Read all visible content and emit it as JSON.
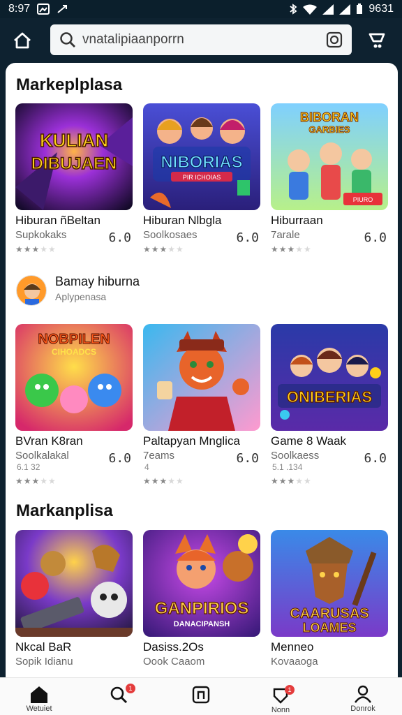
{
  "status_bar": {
    "time": "8:97",
    "battery": "9631"
  },
  "search": {
    "value": "vnatalipiaanporrn"
  },
  "sections": [
    {
      "title": "Markeplplasa"
    },
    {
      "title": "Markanplisa"
    }
  ],
  "row1": [
    {
      "thumb_text": [
        "KULIAN",
        "DIBUJAEN"
      ],
      "name": "Hiburan ñBeltan",
      "sub": "Supkokaks",
      "rating": 3,
      "price": "6.0"
    },
    {
      "thumb_text": [
        "NIBORIAS",
        "PIR ICHOIAS"
      ],
      "name": "Hiburan Nlbgla",
      "sub": "Soolkosaes",
      "rating": 3,
      "price": "6.0"
    },
    {
      "thumb_text": [
        "BIBORAN",
        "GARBIES",
        "PIURO"
      ],
      "name": "Hiburraan",
      "sub": "7arale",
      "rating": 3,
      "price": "6.0"
    }
  ],
  "developer": {
    "name": "Bamay hiburna",
    "sub": "Aplypenasa"
  },
  "row2": [
    {
      "thumb_text": [
        "NOBPILEN",
        "CIHOADCS"
      ],
      "name": "BVran K8ran",
      "sub": "Soolkalakal",
      "extra": "6.1 32",
      "rating": 3,
      "price": "6.0"
    },
    {
      "thumb_text": [],
      "name": "Paltapyan Mnglica",
      "sub": "7eams",
      "extra": "4",
      "rating": 3,
      "price": "6.0"
    },
    {
      "thumb_text": [
        "ONIBERIAS"
      ],
      "name": "Game 8 Waak",
      "sub": "Soolkaess",
      "extra": "5.1 .134",
      "rating": 3,
      "price": "6.0"
    }
  ],
  "row3": [
    {
      "thumb_text": [],
      "name": "Nkcal BaR",
      "sub": "Sopik Idianu"
    },
    {
      "thumb_text": [
        "GANPIRIOS",
        "DANACIPANSH"
      ],
      "name": "Dasiss.2Os",
      "sub": "Oook Caaom"
    },
    {
      "thumb_text": [
        "CAARUSAS",
        "LOAMES"
      ],
      "name": "Menneo",
      "sub": "Kovaaoga"
    }
  ],
  "bottom_nav": [
    {
      "label": "Wetuiet"
    },
    {
      "label": "",
      "badge": "1"
    },
    {
      "label": ""
    },
    {
      "label": "Nonn",
      "badge": "1"
    },
    {
      "label": "Donrok"
    }
  ],
  "colors": {
    "header": "#0e2230",
    "badge": "#e43c3c"
  },
  "icons": [
    "home-icon",
    "search-icon",
    "camera-icon",
    "cart-icon",
    "wifi-icon",
    "bluetooth-icon",
    "profile-icon",
    "bag-icon",
    "ticket-icon"
  ]
}
